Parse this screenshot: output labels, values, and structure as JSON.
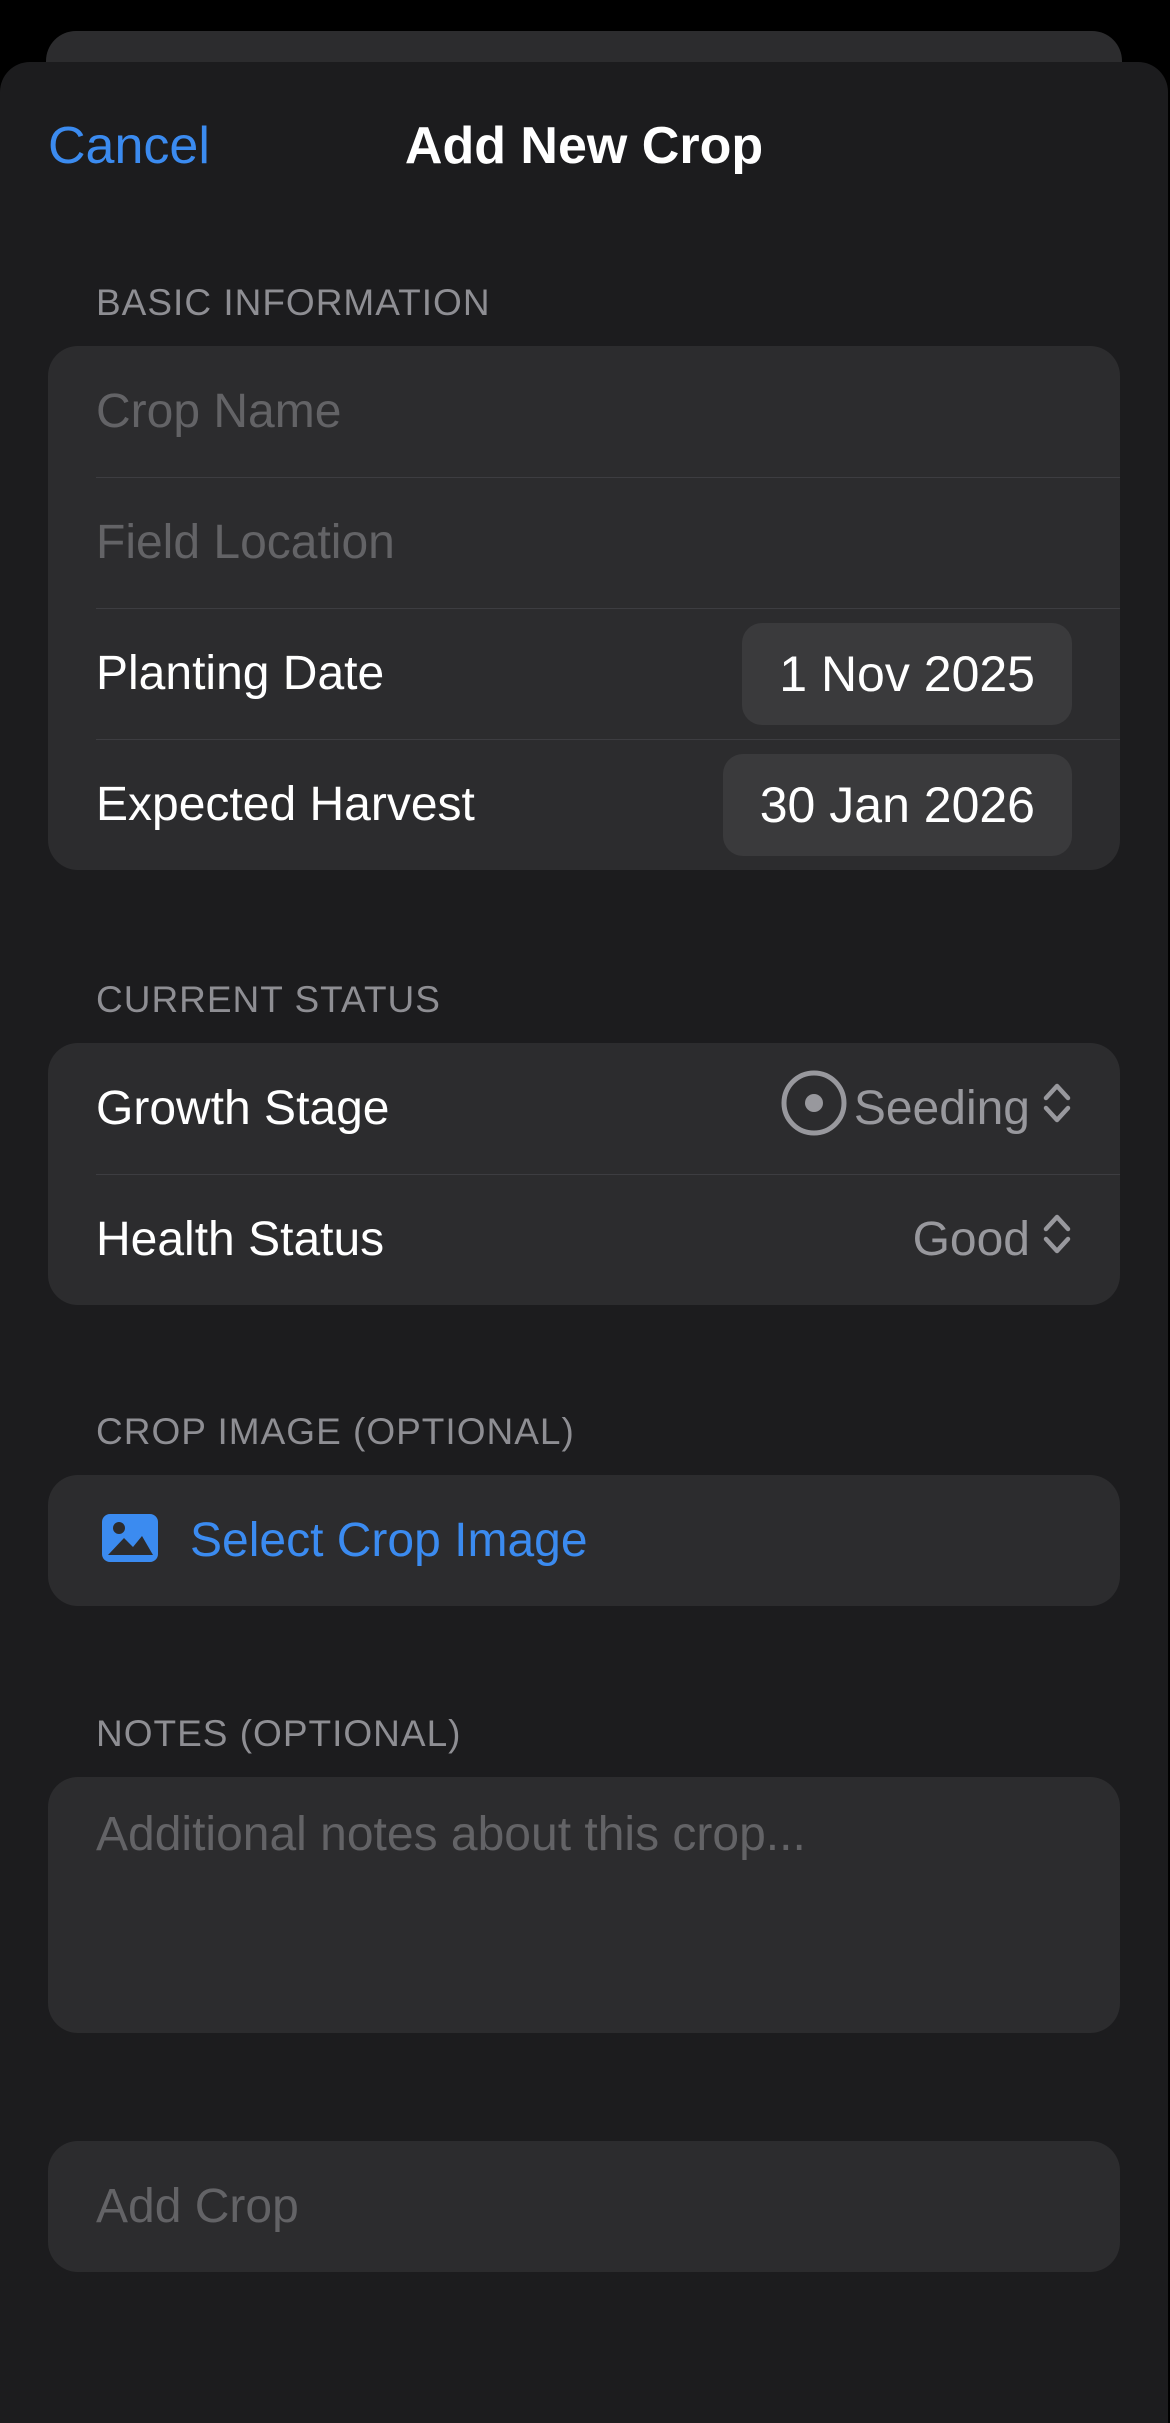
{
  "nav": {
    "cancel_label": "Cancel",
    "title": "Add New Crop"
  },
  "basic_info": {
    "header": "BASIC INFORMATION",
    "crop_name_placeholder": "Crop Name",
    "field_location_placeholder": "Field Location",
    "planting_date_label": "Planting Date",
    "planting_date_value": "1 Nov 2025",
    "expected_harvest_label": "Expected Harvest",
    "expected_harvest_value": "30 Jan 2026"
  },
  "current_status": {
    "header": "CURRENT STATUS",
    "growth_stage_label": "Growth Stage",
    "growth_stage_value": "Seeding",
    "growth_stage_icon": "seed-circle-icon",
    "health_status_label": "Health Status",
    "health_status_value": "Good"
  },
  "crop_image": {
    "header": "CROP IMAGE (OPTIONAL)",
    "select_label": "Select Crop Image",
    "icon": "photo-icon"
  },
  "notes": {
    "header": "NOTES (OPTIONAL)",
    "placeholder": "Additional notes about this crop..."
  },
  "submit": {
    "label": "Add Crop"
  },
  "colors": {
    "accent": "#3b8bf0",
    "background": "#1c1c1e",
    "card": "#2c2c2e",
    "secondary_text": "#8e8e93",
    "placeholder_text": "#636366"
  }
}
